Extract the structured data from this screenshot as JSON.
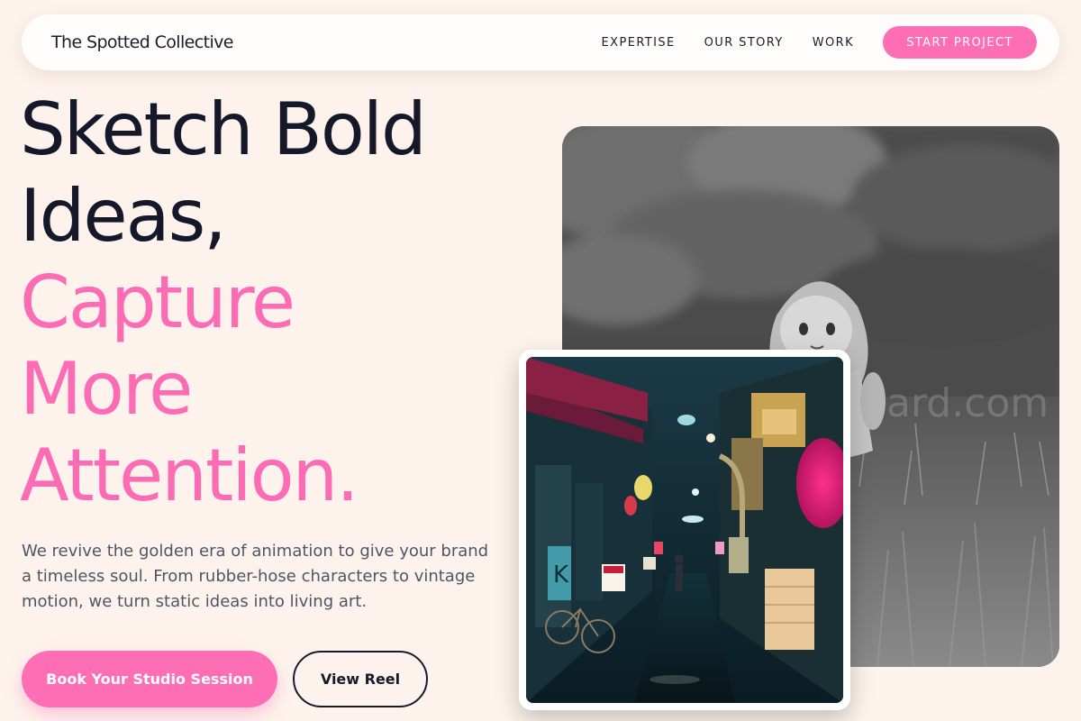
{
  "brand": {
    "name": "The Spotted Collective"
  },
  "nav": {
    "links": [
      "EXPERTISE",
      "OUR STORY",
      "WORK"
    ],
    "cta": "START PROJECT"
  },
  "hero": {
    "headline": {
      "line1": "Sketch Bold",
      "line2": "Ideas,",
      "line3": "Capture",
      "line4": "More",
      "line5": "Attention."
    },
    "lead": "We revive the golden era of animation to give your brand a timeless soul. From rubber-hose characters to vintage motion, we turn static ideas into living art.",
    "primary_button": "Book Your Studio Session",
    "secondary_button": "View Reel"
  },
  "colors": {
    "background": "#fdf3ec",
    "accent": "#fe6eb4",
    "text_dark": "#141829"
  }
}
